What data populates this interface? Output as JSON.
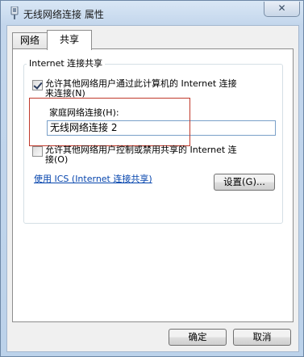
{
  "window": {
    "title": "无线网络连接 属性",
    "close_glyph": "✕"
  },
  "tabs": [
    {
      "label": "网络"
    },
    {
      "label": "共享"
    }
  ],
  "sharing": {
    "group_title": "Internet 连接共享",
    "allow_share": {
      "checked": true,
      "label_line1": "允许其他网络用户通过此计算机的 Internet 连接",
      "label_line2": "来连接(N)"
    },
    "home_connection": {
      "label": "家庭网络连接(H):",
      "value": "无线网络连接 2"
    },
    "allow_control": {
      "checked": false,
      "label_line1": "允许其他网络用户控制或禁用共享的 Internet 连",
      "label_line2": "接(O)"
    },
    "ics_link": "使用 ICS (Internet 连接共享)",
    "settings_button": "设置(G)..."
  },
  "footer": {
    "ok_button": "确定",
    "cancel_button": "取消"
  }
}
